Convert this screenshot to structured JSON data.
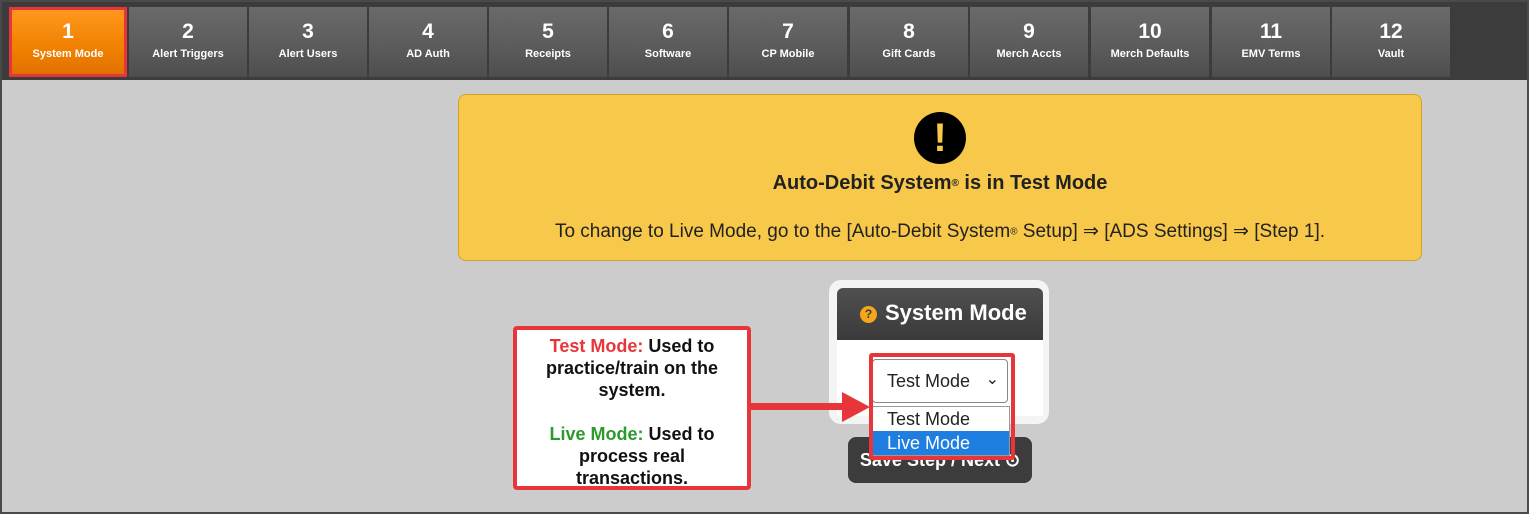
{
  "tabs": [
    {
      "num": "1",
      "label": "System Mode",
      "active": true
    },
    {
      "num": "2",
      "label": "Alert Triggers"
    },
    {
      "num": "3",
      "label": "Alert Users"
    },
    {
      "num": "4",
      "label": "AD Auth"
    },
    {
      "num": "5",
      "label": "Receipts"
    },
    {
      "num": "6",
      "label": "Software"
    },
    {
      "num": "7",
      "label": "CP Mobile"
    },
    {
      "num": "8",
      "label": "Gift Cards"
    },
    {
      "num": "9",
      "label": "Merch Accts"
    },
    {
      "num": "10",
      "label": "Merch Defaults"
    },
    {
      "num": "11",
      "label": "EMV Terms"
    },
    {
      "num": "12",
      "label": "Vault"
    }
  ],
  "banner": {
    "icon": "!",
    "title_pre": "Auto-Debit System",
    "reg": "®",
    "title_post": " is in Test Mode",
    "sub_pre": "To change to Live Mode, go to the [Auto-Debit System",
    "sub_post": " Setup] ⇒ [ADS Settings] ⇒ [Step 1]."
  },
  "card": {
    "help_icon": "?",
    "title": "System Mode",
    "selected": "Test Mode",
    "options": [
      "Test Mode",
      "Live Mode"
    ],
    "highlighted_option": "Live Mode",
    "save_label": "Save Step / Next",
    "save_icon": "⊙"
  },
  "callout": {
    "test_label": "Test Mode:",
    "test_text_1": " Used to",
    "test_text_2": "practice/train on the",
    "test_text_3": "system.",
    "live_label": "Live Mode:",
    "live_text_1": " Used to",
    "live_text_2": "process real",
    "live_text_3": "transactions."
  },
  "colors": {
    "active_tab": "#f08000",
    "banner_bg": "#f8c84a",
    "highlight": "#e8353a",
    "test_mode": "#e8353a",
    "live_mode": "#2c9a2c",
    "option_selected": "#1f7fe0"
  }
}
